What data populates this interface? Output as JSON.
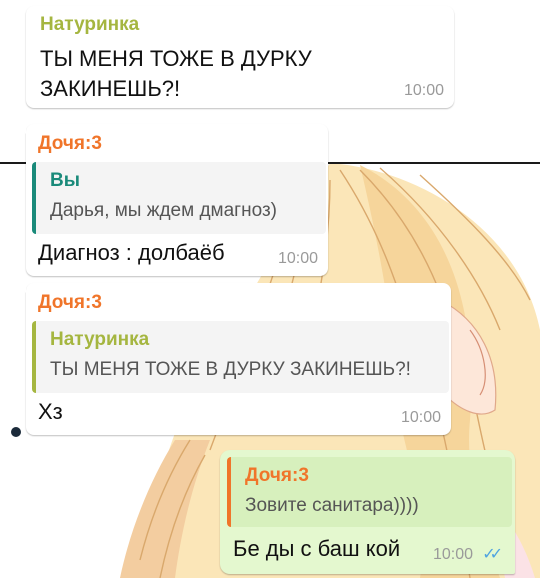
{
  "chat": {
    "messages": [
      {
        "sender": "Натуринка",
        "text_lines": [
          "ТЫ МЕНЯ ТОЖЕ В ДУРКУ",
          "ЗАКИНЕШЬ?!"
        ],
        "time": "10:00"
      },
      {
        "sender": "Дочя:3",
        "reply_to": {
          "sender": "Вы",
          "text": "Дарья, мы ждем дмагноз)"
        },
        "text": "Диагноз : долбаёб",
        "time": "10:00"
      },
      {
        "sender": "Дочя:3",
        "reply_to": {
          "sender": "Натуринка",
          "text": "ТЫ МЕНЯ ТОЖЕ В ДУРКУ ЗАКИНЕШЬ?!"
        },
        "text": "Хз",
        "time": "10:00"
      },
      {
        "reply_to": {
          "sender": "Дочя:3",
          "text": "Зовите санитара))))"
        },
        "text": "Бе ды с баш кой",
        "time": "10:00",
        "read_status_icon": "double-check-icon"
      }
    ]
  },
  "colors": {
    "natur": "#a5b640",
    "docha": "#f0752a",
    "you": "#1a8a7a",
    "outgoing_bubble": "#e4f8cf",
    "read_check": "#4fa3e0"
  }
}
